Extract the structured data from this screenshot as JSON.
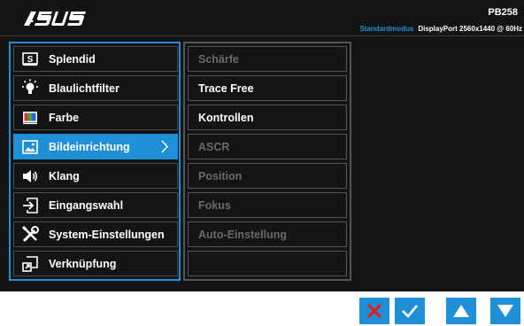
{
  "header": {
    "brand": "ASUS",
    "model": "PB258",
    "mode": "Standardmodus",
    "signal": "DisplayPort  2560x1440 @ 60Hz"
  },
  "main_menu": {
    "items": [
      {
        "label": "Splendid",
        "icon": "splendid-icon",
        "active": false
      },
      {
        "label": "Blaulichtfilter",
        "icon": "bulb-icon",
        "active": false
      },
      {
        "label": "Farbe",
        "icon": "color-icon",
        "active": false
      },
      {
        "label": "Bildeinrichtung",
        "icon": "image-icon",
        "active": true
      },
      {
        "label": "Klang",
        "icon": "speaker-icon",
        "active": false
      },
      {
        "label": "Eingangswahl",
        "icon": "input-icon",
        "active": false
      },
      {
        "label": "System-Einstellungen",
        "icon": "wrench-screwdriver-icon",
        "active": false
      },
      {
        "label": "Verknüpfung",
        "icon": "shortcut-icon",
        "active": false
      }
    ]
  },
  "sub_menu": {
    "items": [
      {
        "label": "Schärfe",
        "enabled": false
      },
      {
        "label": "Trace Free",
        "enabled": true
      },
      {
        "label": "Kontrollen",
        "enabled": true
      },
      {
        "label": "ASCR",
        "enabled": false
      },
      {
        "label": "Position",
        "enabled": false
      },
      {
        "label": "Fokus",
        "enabled": false
      },
      {
        "label": "Auto-Einstellung",
        "enabled": false
      },
      {
        "label": "",
        "enabled": false
      }
    ]
  },
  "nav_buttons": [
    {
      "name": "close-button",
      "icon": "close-icon"
    },
    {
      "name": "confirm-button",
      "icon": "check-icon"
    },
    {
      "name": "up-button",
      "icon": "triangle-up-icon"
    },
    {
      "name": "down-button",
      "icon": "triangle-down-icon"
    }
  ],
  "colors": {
    "accent": "#1f8fd6",
    "close": "#e02020",
    "background": "#141414",
    "disabled_text": "#6a6a6a"
  }
}
